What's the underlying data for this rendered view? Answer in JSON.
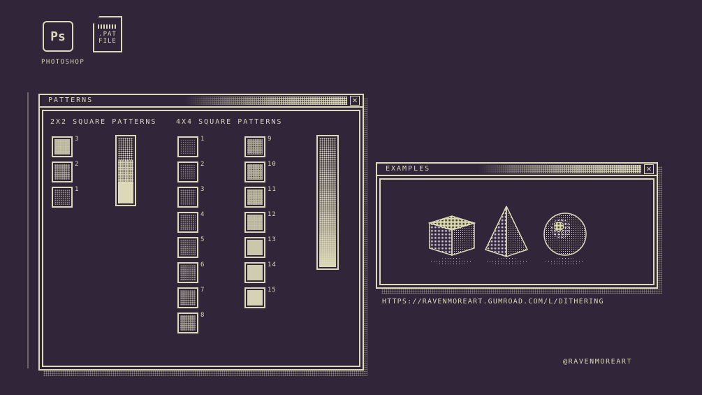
{
  "desktop": {
    "photoshop_icon_text": "Ps",
    "photoshop_label": "PHOTOSHOP",
    "pat_file_line1": ".PAT",
    "pat_file_line2": "FILE"
  },
  "patterns_window": {
    "title": "PATTERNS",
    "close_glyph": "✕",
    "section_2x2": "2X2 SQUARE PATTERNS",
    "section_4x4": "4X4 SQUARE PATTERNS",
    "patterns_2x2": [
      {
        "label": "3",
        "density": 0.75
      },
      {
        "label": "2",
        "density": 0.5
      },
      {
        "label": "1",
        "density": 0.25
      }
    ],
    "patterns_4x4_col1": [
      {
        "label": "1",
        "density": 0.0625
      },
      {
        "label": "2",
        "density": 0.125
      },
      {
        "label": "3",
        "density": 0.1875
      },
      {
        "label": "4",
        "density": 0.25
      },
      {
        "label": "5",
        "density": 0.3125
      },
      {
        "label": "6",
        "density": 0.375
      },
      {
        "label": "7",
        "density": 0.4375
      },
      {
        "label": "8",
        "density": 0.5
      }
    ],
    "patterns_4x4_col2": [
      {
        "label": "9",
        "density": 0.5625
      },
      {
        "label": "10",
        "density": 0.625
      },
      {
        "label": "11",
        "density": 0.6875
      },
      {
        "label": "12",
        "density": 0.75
      },
      {
        "label": "13",
        "density": 0.8125
      },
      {
        "label": "14",
        "density": 0.875
      },
      {
        "label": "15",
        "density": 0.9375
      }
    ]
  },
  "examples_window": {
    "title": "EXAMPLES",
    "close_glyph": "✕",
    "shapes": [
      "cube",
      "pyramid",
      "sphere"
    ]
  },
  "link_text": "HTTPS://RAVENMOREART.GUMROAD.COM/L/DITHERING",
  "handle_text": "@RAVENMOREART",
  "colors": {
    "background": "#31253a",
    "foreground": "#ddd8b8"
  }
}
